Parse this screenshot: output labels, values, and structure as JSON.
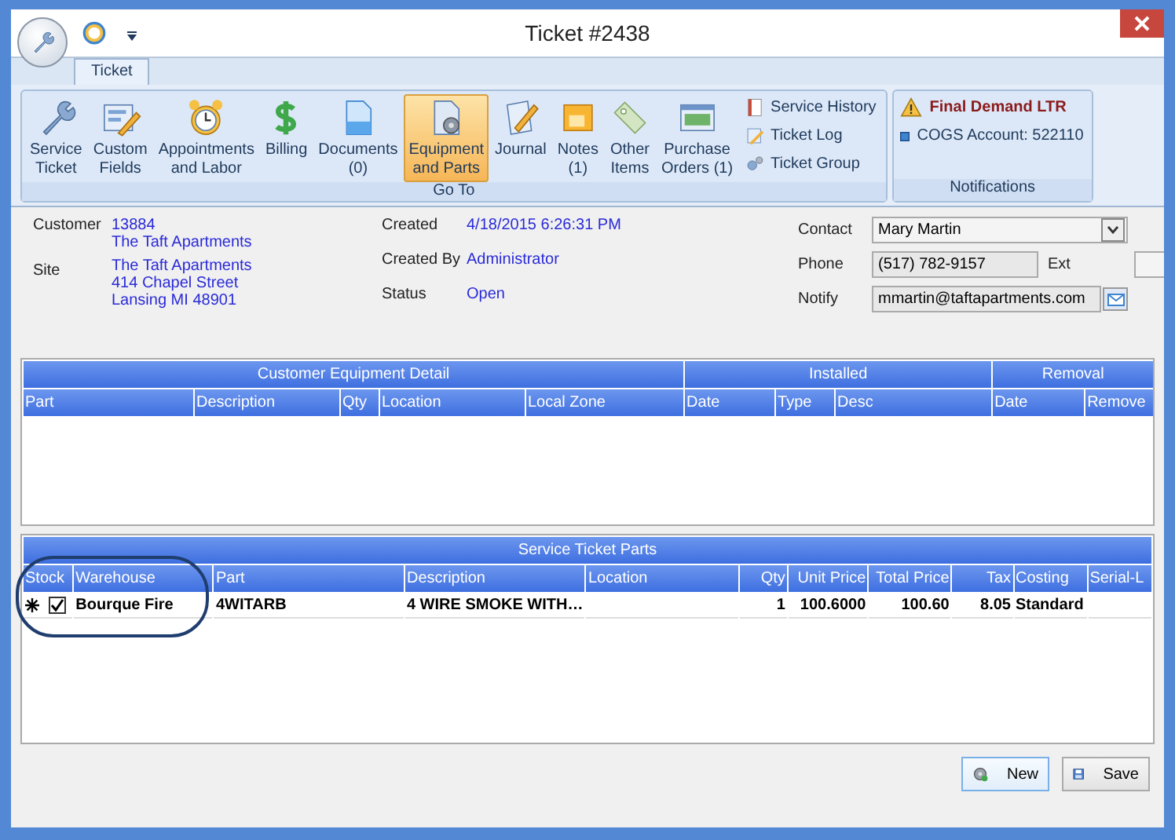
{
  "window": {
    "title": "Ticket #2438"
  },
  "tabs": [
    {
      "label": "Ticket",
      "selected": true
    }
  ],
  "ribbon": {
    "groups": [
      {
        "label": "Go To",
        "buttons": [
          {
            "label": "Service\nTicket",
            "selected": false
          },
          {
            "label": "Custom\nFields",
            "selected": false
          },
          {
            "label": "Appointments\nand Labor",
            "selected": false
          },
          {
            "label": "Billing",
            "selected": false
          },
          {
            "label": "Documents\n(0)",
            "selected": false
          },
          {
            "label": "Equipment\nand Parts",
            "selected": true
          },
          {
            "label": "Journal",
            "selected": false
          },
          {
            "label": "Notes\n(1)",
            "selected": false
          },
          {
            "label": "Other\nItems",
            "selected": false
          },
          {
            "label": "Purchase\nOrders (1)",
            "selected": false
          }
        ],
        "links": [
          "Service History",
          "Ticket Log",
          "Ticket Group"
        ]
      }
    ],
    "notifications": {
      "label": "Notifications",
      "items": [
        {
          "kind": "warning",
          "text": "Final Demand LTR"
        },
        {
          "kind": "info",
          "text": "COGS Account: 522110"
        }
      ]
    }
  },
  "info": {
    "left": [
      {
        "label": "Customer",
        "lines": [
          "13884",
          "The Taft Apartments"
        ]
      },
      {
        "label": "Site",
        "lines": [
          "The Taft Apartments",
          "414 Chapel Street",
          "Lansing MI 48901"
        ]
      }
    ],
    "middle": [
      {
        "label": "Created",
        "value": "4/18/2015 6:26:31 PM"
      },
      {
        "label": "Created By",
        "value": "Administrator"
      },
      {
        "label": "Status",
        "value": "Open"
      }
    ],
    "contact": {
      "label": "Contact",
      "value": "Mary Martin"
    },
    "phone": {
      "label": "Phone",
      "value": "(517) 782-9157",
      "ext_label": "Ext"
    },
    "notify": {
      "label": "Notify",
      "value": "mmartin@taftapartments.com"
    }
  },
  "equipment": {
    "groups": [
      {
        "label": "Customer Equipment Detail"
      },
      {
        "label": "Installed"
      },
      {
        "label": "Removal"
      }
    ],
    "columns": [
      "Part",
      "Description",
      "Qty",
      "Location",
      "Local Zone",
      "Date",
      "Type",
      "Desc",
      "Date",
      "Remove"
    ]
  },
  "parts": {
    "title": "Service Ticket Parts",
    "columns": [
      "Stock",
      "Warehouse",
      "Part",
      "Description",
      "Location",
      "Qty",
      "Unit Price",
      "Total Price",
      "Tax",
      "Costing",
      "Serial-L"
    ],
    "rows": [
      {
        "new_row": true,
        "stock": true,
        "warehouse": "Bourque Fire",
        "part": "4WITARB",
        "description": "4 WIRE SMOKE WITH…",
        "qty": "1",
        "unit_price": "100.6000",
        "total_price": "100.60",
        "tax": "8.05",
        "costing": "Standard"
      }
    ]
  },
  "buttons": [
    {
      "kind": "new",
      "label": "New",
      "selected": true
    },
    {
      "kind": "save",
      "label": "Save",
      "selected": false
    }
  ]
}
